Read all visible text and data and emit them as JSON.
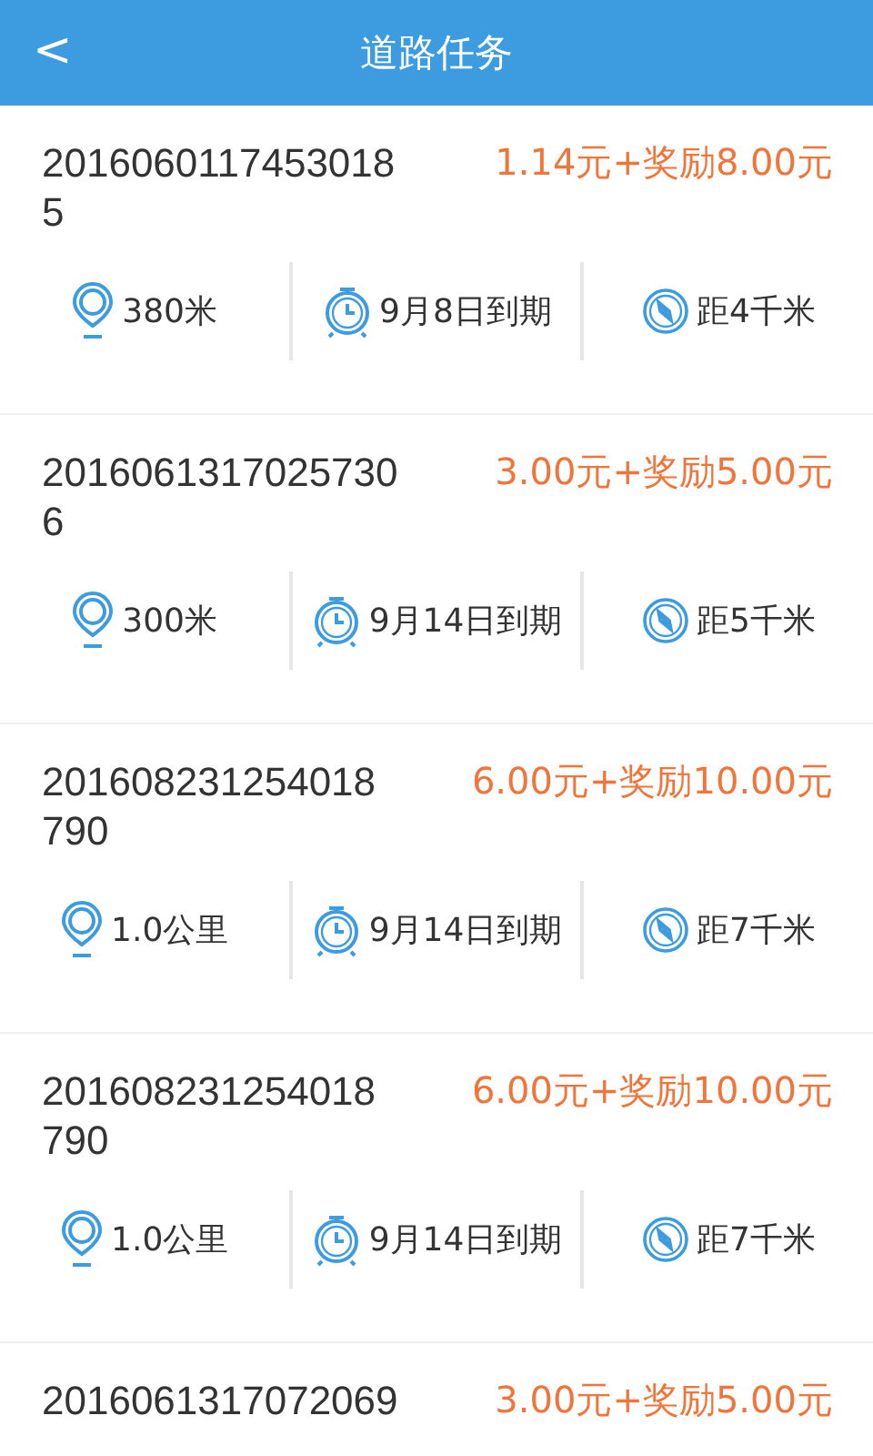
{
  "header": {
    "back": "<",
    "title": "道路任务"
  },
  "tasks": [
    {
      "id": "2016060117453018\n5",
      "price": "1.14元+奖励8.00元",
      "stats": [
        {
          "kind": "distance",
          "text": "380米"
        },
        {
          "kind": "deadline",
          "text": "9月8日到期"
        },
        {
          "kind": "away",
          "text": "距4千米"
        }
      ]
    },
    {
      "id": "2016061317025730\n6",
      "price": "3.00元+奖励5.00元",
      "stats": [
        {
          "kind": "distance",
          "text": "300米"
        },
        {
          "kind": "deadline",
          "text": "9月14日到期"
        },
        {
          "kind": "away",
          "text": "距5千米"
        }
      ]
    },
    {
      "id": "201608231254018\n790",
      "price": "6.00元+奖励10.00元",
      "stats": [
        {
          "kind": "distance",
          "text": "1.0公里"
        },
        {
          "kind": "deadline",
          "text": "9月14日到期"
        },
        {
          "kind": "away",
          "text": "距7千米"
        }
      ]
    },
    {
      "id": "201608231254018\n790",
      "price": "6.00元+奖励10.00元",
      "stats": [
        {
          "kind": "distance",
          "text": "1.0公里"
        },
        {
          "kind": "deadline",
          "text": "9月14日到期"
        },
        {
          "kind": "away",
          "text": "距7千米"
        }
      ]
    },
    {
      "id": "2016061317072069",
      "price": "3.00元+奖励5.00元"
    }
  ]
}
